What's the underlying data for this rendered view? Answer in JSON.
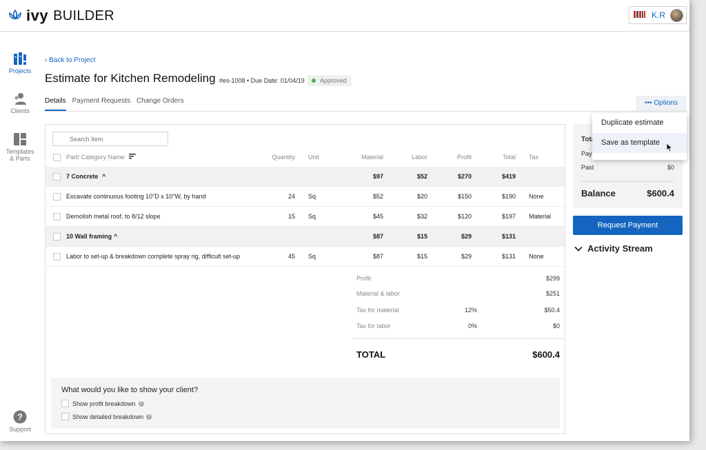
{
  "app": {
    "logo_ivy": "ivy",
    "logo_builder": "BUILDER",
    "user_initials": "K.R",
    "accent": "#1565c0"
  },
  "sidebar": {
    "items": [
      {
        "label": "Projects",
        "icon": "projects-icon",
        "active": true
      },
      {
        "label": "Clients",
        "icon": "clients-icon"
      },
      {
        "label": "Templates",
        "label2": "& Parts",
        "icon": "templates-icon"
      },
      {
        "label": "Support",
        "icon": "support-icon"
      }
    ]
  },
  "header": {
    "back_link": "Back to Project",
    "title": "Estimate for Kitchen Remodeling",
    "meta": "#es-1008 • Due Date: 01/04/19",
    "status": "Approved"
  },
  "tabs": [
    "Details",
    "Payment Requests",
    "Change Orders"
  ],
  "options": {
    "label": "Options",
    "menu": [
      "Duplicate estimate",
      "Save as template"
    ]
  },
  "search": {
    "placeholder": "Search Item"
  },
  "table": {
    "columns": {
      "part": "Part/ Category Name",
      "quantity": "Quantity",
      "unit": "Unit",
      "material": "Material",
      "labor": "Labor",
      "profit": "Profit",
      "total": "Total",
      "tax": "Tax"
    },
    "rows": [
      {
        "type": "category",
        "name": "7 Concrete",
        "material": "$97",
        "labor": "$52",
        "profit": "$270",
        "total": "$419"
      },
      {
        "type": "item",
        "name": "Excavate continuous footing 10\"D x 10\"W, by hand",
        "quantity": "24",
        "unit": "Sq",
        "material": "$52",
        "labor": "$20",
        "profit": "$150",
        "total": "$190",
        "tax": "None"
      },
      {
        "type": "item",
        "name": "Demolish metal roof, to 8/12 slope",
        "quantity": "15",
        "unit": "Sq",
        "material": "$45",
        "labor": "$32",
        "profit": "$120",
        "total": "$197",
        "tax": "Material"
      },
      {
        "type": "category",
        "name": "10 Wall framing",
        "material": "$87",
        "labor": "$15",
        "profit": "$29",
        "total": "$131"
      },
      {
        "type": "item",
        "name": "Labor to set-up & breakdown complete spray rig, difficult set-up",
        "quantity": "45",
        "unit": "Sq",
        "material": "$87",
        "labor": "$15",
        "profit": "$29",
        "total": "$131",
        "tax": "None"
      }
    ]
  },
  "summary": {
    "profit_label": "Profit",
    "profit": "$299",
    "matlab_label": "Material & labor",
    "matlab": "$251",
    "taxmat_label": "Tax for material",
    "taxmat_rate": "12%",
    "taxmat": "$50.4",
    "taxlab_label": "Tax for labor",
    "taxlab_rate": "0%",
    "taxlab": "$0",
    "total_label": "TOTAL",
    "total": "$600.4"
  },
  "client_options": {
    "question": "What would you like to show your client?",
    "items": [
      "Show profit breakdown",
      "Show detailed breakdown"
    ]
  },
  "payment": {
    "total_label": "Tota",
    "payments_label": "Pay",
    "paid_label": "Paid",
    "paid": "$0",
    "balance_label": "Balance",
    "balance": "$600.4",
    "request_button": "Request Payment",
    "activity_label": "Activity Stream"
  }
}
